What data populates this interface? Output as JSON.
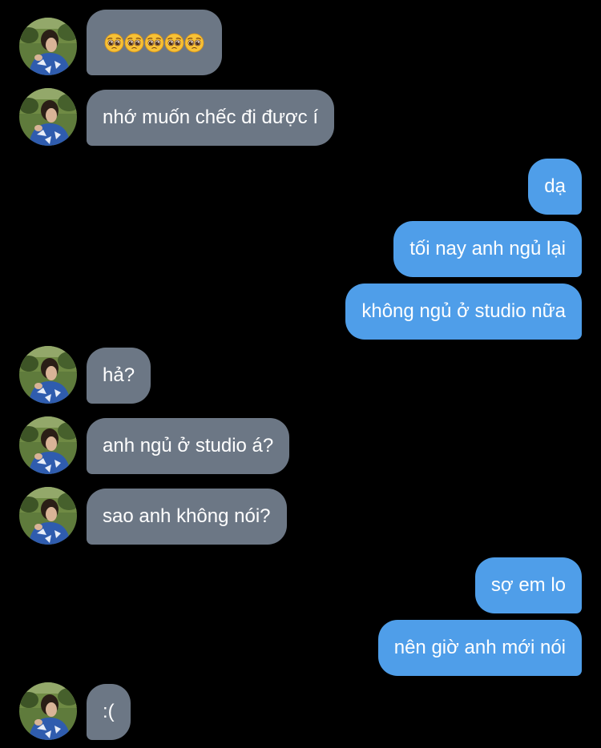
{
  "contact": {
    "avatar_icon": "profile-photo"
  },
  "messages": [
    {
      "side": "in",
      "text": "🥺🥺🥺🥺🥺",
      "emoji": "pleading-face",
      "emoji_count": 5
    },
    {
      "side": "in",
      "text": "nhớ muốn chếc đi được í"
    },
    {
      "side": "out",
      "text": "dạ"
    },
    {
      "side": "out",
      "text": "tối nay anh ngủ lại"
    },
    {
      "side": "out",
      "text": "không ngủ ở studio nữa"
    },
    {
      "side": "in",
      "text": "hả?"
    },
    {
      "side": "in",
      "text": "anh ngủ ở studio á?"
    },
    {
      "side": "in",
      "text": "sao anh không nói?"
    },
    {
      "side": "out",
      "text": "sợ em lo"
    },
    {
      "side": "out",
      "text": "nên giờ anh mới nói"
    },
    {
      "side": "in",
      "text": ":("
    }
  ],
  "colors": {
    "background": "#000000",
    "incoming_bubble": "#6c7785",
    "outgoing_bubble": "#4f9ee9",
    "text": "#ffffff"
  }
}
